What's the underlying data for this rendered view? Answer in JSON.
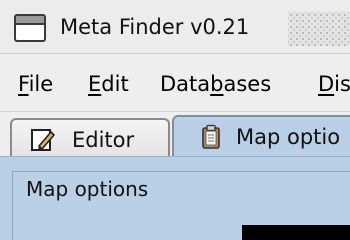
{
  "window": {
    "title": "Meta Finder v0.21",
    "icon": "window-icon"
  },
  "menu": {
    "file_mnemonic": "F",
    "file_rest": "ile",
    "edit_mnemonic": "E",
    "edit_rest": "dit",
    "db_pre": "Data",
    "db_mnemonic": "b",
    "db_post": "ases",
    "dis_mnemonic": "D",
    "dis_rest": "is"
  },
  "tabs": [
    {
      "label": "Editor",
      "icon": "pencil-icon",
      "selected": false
    },
    {
      "label": "Map optio",
      "icon": "clipboard-icon",
      "selected": true
    }
  ],
  "panel": {
    "group_title": "Map options"
  },
  "colors": {
    "panel_bg": "#b8cfe5",
    "window_bg": "#eeeeee",
    "border": "#8a8a8a"
  }
}
